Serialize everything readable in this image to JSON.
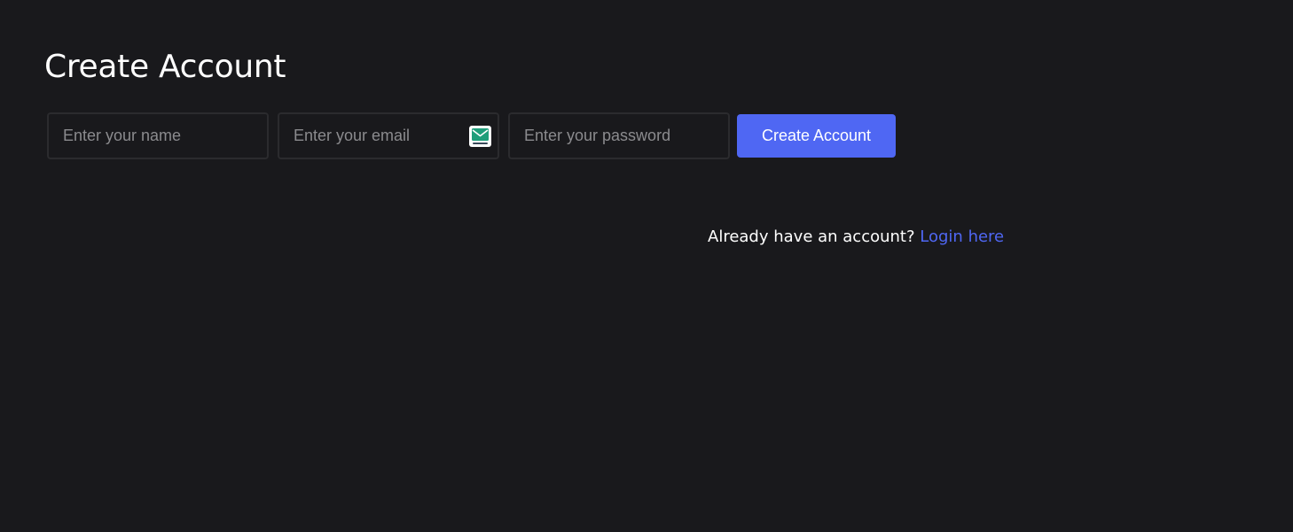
{
  "header": {
    "title": "Create Account"
  },
  "form": {
    "name_placeholder": "Enter your name",
    "email_placeholder": "Enter your email",
    "password_placeholder": "Enter your password",
    "submit_label": "Create Account",
    "email_badge_icon": "temp-mail-envelope-icon"
  },
  "footer": {
    "prompt": "Already have an account?",
    "link_label": "Login here"
  },
  "colors": {
    "background": "#19191c",
    "accent": "#4f67f3",
    "input_border": "#2b2b2e"
  }
}
